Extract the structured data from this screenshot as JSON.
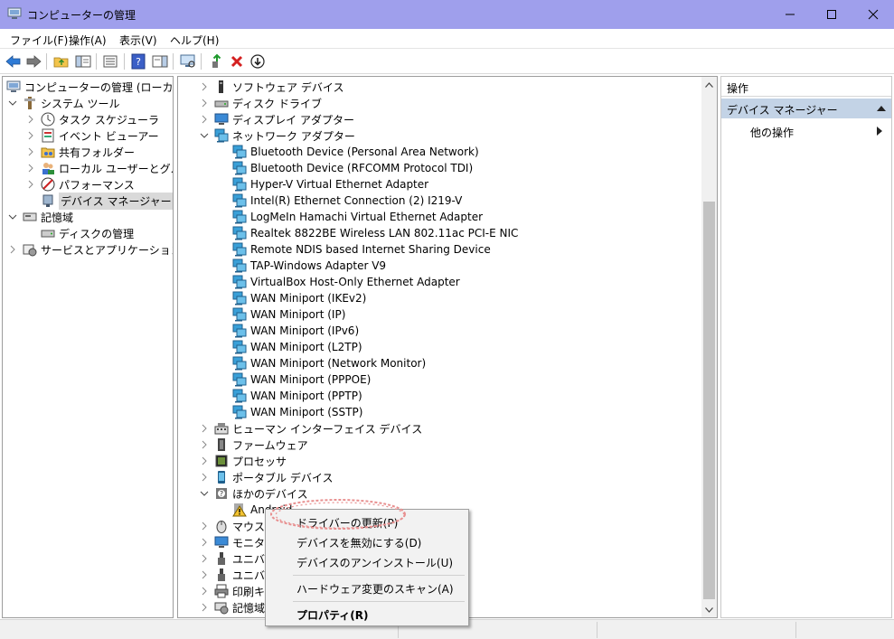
{
  "window": {
    "title": "コンピューターの管理"
  },
  "menubar": {
    "items": [
      "ファイル(F)",
      "操作(A)",
      "表示(V)",
      "ヘルプ(H)"
    ]
  },
  "left_tree": {
    "root": "コンピューターの管理 (ローカル)",
    "system_tools": "システム ツール",
    "task_scheduler": "タスク スケジューラ",
    "event_viewer": "イベント ビューアー",
    "shared_folders": "共有フォルダー",
    "local_users": "ローカル ユーザーとグループ",
    "performance": "パフォーマンス",
    "device_manager": "デバイス マネージャー",
    "storage": "記憶域",
    "disk_management": "ディスクの管理",
    "services": "サービスとアプリケーション"
  },
  "device_tree": {
    "software_devices": "ソフトウェア デバイス",
    "disk_drives": "ディスク ドライブ",
    "display_adapters": "ディスプレイ アダプター",
    "network_adapters": "ネットワーク アダプター",
    "network_items": [
      "Bluetooth Device (Personal Area Network)",
      "Bluetooth Device (RFCOMM Protocol TDI)",
      "Hyper-V Virtual Ethernet Adapter",
      "Intel(R) Ethernet Connection (2) I219-V",
      "LogMeIn Hamachi Virtual Ethernet Adapter",
      "Realtek 8822BE Wireless LAN 802.11ac PCI-E NIC",
      "Remote NDIS based Internet Sharing Device",
      "TAP-Windows Adapter V9",
      "VirtualBox Host-Only Ethernet Adapter",
      "WAN Miniport (IKEv2)",
      "WAN Miniport (IP)",
      "WAN Miniport (IPv6)",
      "WAN Miniport (L2TP)",
      "WAN Miniport (Network Monitor)",
      "WAN Miniport (PPPOE)",
      "WAN Miniport (PPTP)",
      "WAN Miniport (SSTP)"
    ],
    "hid": "ヒューマン インターフェイス デバイス",
    "firmware": "ファームウェア",
    "processor": "プロセッサ",
    "portable": "ポータブル デバイス",
    "other_devices": "ほかのデバイス",
    "android": "Android",
    "mouse": "マウスと",
    "monitor": "モニター",
    "universal1": "ユニバー",
    "universal2": "ユニバー",
    "print": "印刷キ",
    "storage_ctrl": "記憶域"
  },
  "actions_pane": {
    "header": "操作",
    "section": "デバイス マネージャー",
    "other_actions": "他の操作"
  },
  "context_menu": {
    "update_driver": "ドライバーの更新(P)",
    "disable": "デバイスを無効にする(D)",
    "uninstall": "デバイスのアンインストール(U)",
    "scan": "ハードウェア変更のスキャン(A)",
    "properties": "プロパティ(R)"
  },
  "colors": {
    "titlebar": "#9f9fec",
    "selection": "#c3d3e6",
    "annotation": "#e89090"
  }
}
